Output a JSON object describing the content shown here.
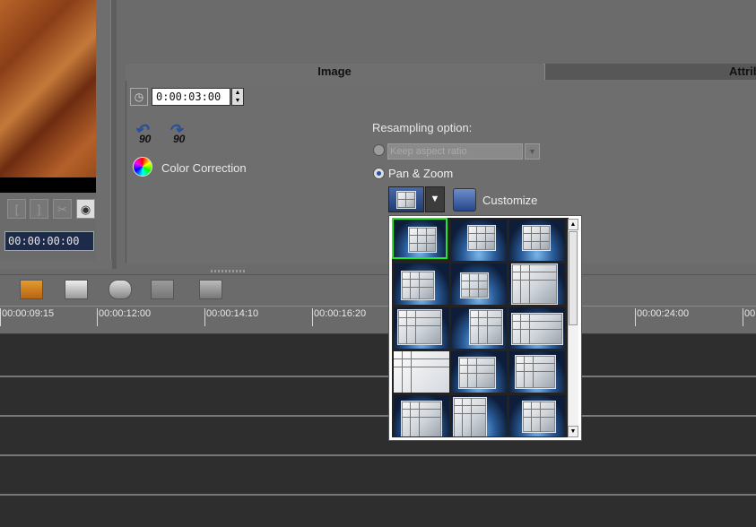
{
  "clip_controls": {
    "mark_in": "[",
    "mark_out": "]",
    "scissors": "✂",
    "snapshot": "◉",
    "timecode": "00:00:00:00"
  },
  "tabs": {
    "image": "Image",
    "attribute": "Attrib"
  },
  "duration": {
    "value": "0:00:03:00"
  },
  "rotate": {
    "left_label": "90",
    "right_label": "90"
  },
  "color_correction": {
    "label": "Color Correction"
  },
  "resampling": {
    "label": "Resampling option:",
    "keep_aspect_placeholder": "Keep aspect ratio",
    "pan_zoom_label": "Pan & Zoom",
    "selected": "Pan & Zoom"
  },
  "customize": {
    "label": "Customize"
  },
  "ruler": {
    "ticks": [
      "00:00:09:15",
      "00:00:12:00",
      "00:00:14:10",
      "00:00:16:20",
      "00:00:24:00",
      "00"
    ]
  },
  "preset_grid": {
    "rows": 5,
    "columns": 3,
    "selected_index": 0
  },
  "colors": {
    "selection": "#27e627",
    "panel": "#6e6e6e",
    "track_bg": "#2e2e2e"
  }
}
